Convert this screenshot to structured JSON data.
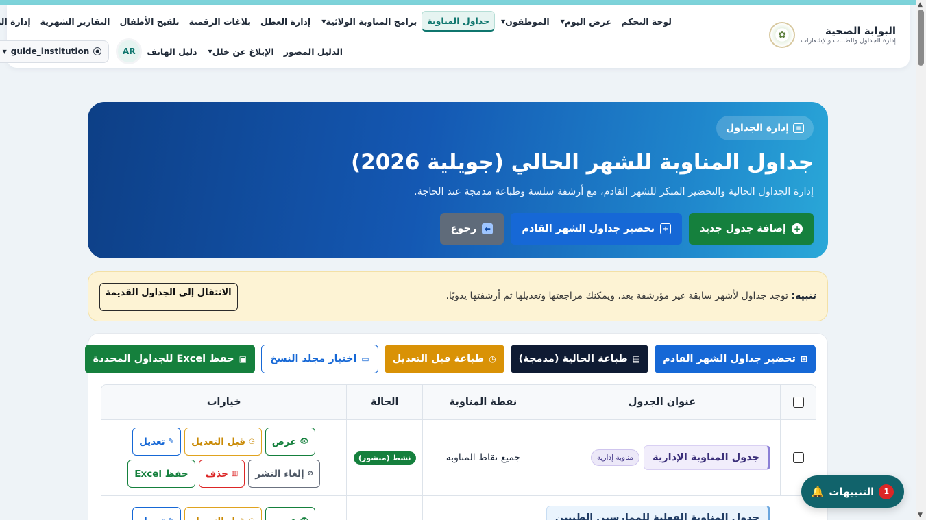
{
  "colors": {
    "primary_blue": "#1668d6",
    "primary_green": "#15803d",
    "teal_active": "#0f766e",
    "warning_bg": "#fdf3d4",
    "hero_gradient_start": "#0d3f86",
    "hero_gradient_end": "#2aa8d8"
  },
  "brand": {
    "title": "البوابة الصحية",
    "subtitle": "إدارة الجداول والطلبات والإشعارات",
    "logo_icon": "emblem-icon"
  },
  "nav": {
    "row1": [
      {
        "label": "لوحة التحكم",
        "active": false,
        "dropdown": false
      },
      {
        "label": "عرض اليوم",
        "active": false,
        "dropdown": true
      },
      {
        "label": "الموظفون",
        "active": false,
        "dropdown": true
      },
      {
        "label": "جداول المناوبة",
        "active": true,
        "dropdown": false
      },
      {
        "label": "برامج المناوبة الولائية",
        "active": false,
        "dropdown": true
      },
      {
        "label": "إدارة العطل",
        "active": false,
        "dropdown": false
      },
      {
        "label": "بلاغات الرقمنة",
        "active": false,
        "dropdown": false
      },
      {
        "label": "تلقيح الأطفال",
        "active": false,
        "dropdown": false
      },
      {
        "label": "التقارير الشهرية",
        "active": false,
        "dropdown": false
      },
      {
        "label": "إدارة التبديلات",
        "active": false,
        "dropdown": false
      }
    ],
    "row2": [
      {
        "label": "الدليل المصور",
        "dropdown": false
      },
      {
        "label": "الإبلاغ عن خلل",
        "dropdown": true
      },
      {
        "label": "دليل الهاتف",
        "dropdown": false
      }
    ],
    "avatar_initials": "AR",
    "user_name": "guide_institution"
  },
  "hero": {
    "badge": "إدارة الجداول",
    "title": "جداول المناوبة للشهر الحالي (جويلية 2026)",
    "subtitle": "إدارة الجداول الحالية والتحضير المبكر للشهر القادم، مع أرشفة سلسة وطباعة مدمجة عند الحاجة.",
    "add_label": "إضافة جدول جديد",
    "prepare_label": "تحضير جداول الشهر القادم",
    "back_label": "رجوع"
  },
  "warning": {
    "label": "تنبيه:",
    "text": "توجد جداول لأشهر سابقة غير مؤرشفة بعد، ويمكنك مراجعتها وتعديلها ثم أرشفتها يدويًا.",
    "button": "الانتقال إلى الجداول القديمة"
  },
  "toolbar": {
    "prepare": "تحضير جداول الشهر القادم",
    "print_current": "طباعة الحالية (مدمجة)",
    "print_before": "طباعة قبل التعديل",
    "choose_folder": "اختيار مجلد النسخ",
    "save_excel": "حفظ Excel للجداول المحددة"
  },
  "table": {
    "headers": {
      "title": "عنوان الجدول",
      "point": "نقطة المناوبة",
      "status": "الحالة",
      "options": "خيارات"
    },
    "rows": [
      {
        "title": "جدول المناوبة الإدارية",
        "tag": "مناوبة إدارية",
        "point": "جميع نقاط المناوبة",
        "status": "نشط (منشور)"
      },
      {
        "title": "جدول المناوبة الفعلية للممارسين الطبيين",
        "tag": "",
        "point": "",
        "status": ""
      }
    ],
    "actions": {
      "view": "عرض",
      "before_edit": "قبل التعديل",
      "edit": "تعديل",
      "unpublish": "إلغاء النشر",
      "delete": "حذف",
      "save_excel": "حفظ Excel"
    }
  },
  "notifications": {
    "label": "التنبيهات",
    "count": "1"
  }
}
